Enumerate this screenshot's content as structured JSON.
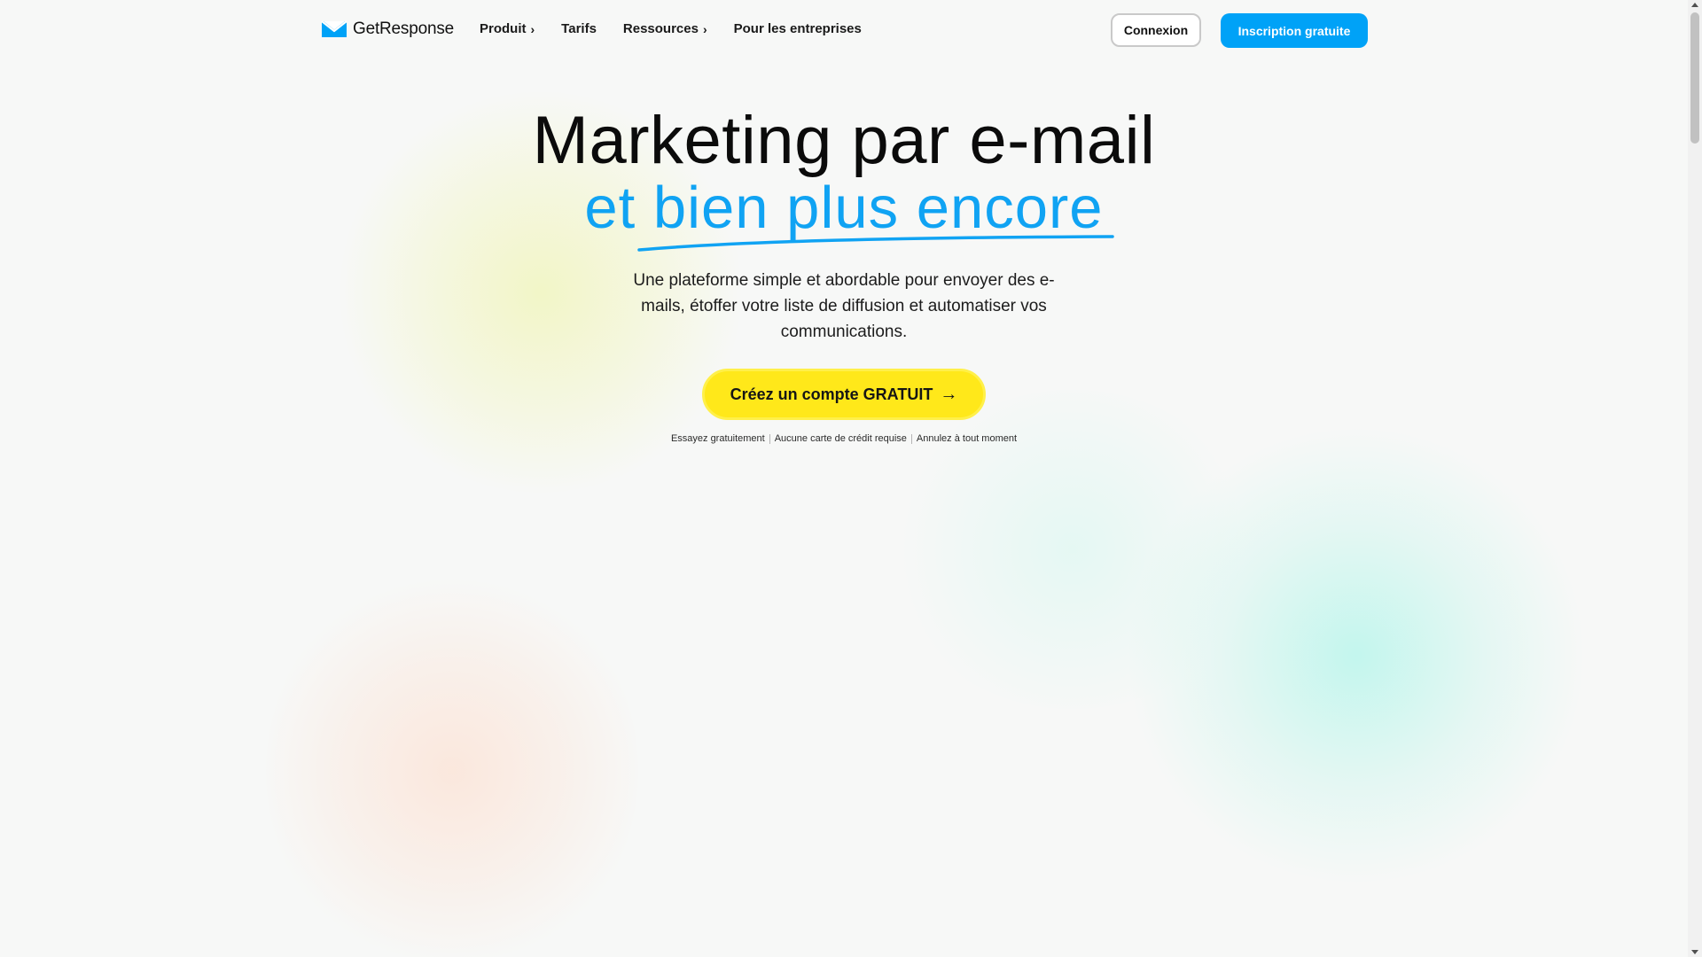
{
  "header": {
    "logo_text": "GetResponse",
    "nav": [
      {
        "label": "Produit",
        "chevron": "›"
      },
      {
        "label": "Tarifs",
        "chevron": ""
      },
      {
        "label": "Ressources",
        "chevron": "›"
      },
      {
        "label": "Pour les entreprises",
        "chevron": ""
      }
    ],
    "login_label": "Connexion",
    "signup_label": "Inscription gratuite"
  },
  "hero": {
    "title_line1": "Marketing par e-mail",
    "title_line2": "et bien plus encore",
    "subtitle": "Une plateforme simple et abordable pour envoyer des e-mails, étoffer votre liste de diffusion et automatiser vos communications.",
    "cta_label": "Créez un compte GRATUIT",
    "cta_arrow": "→",
    "perks": [
      "Essayez gratuitement",
      "Aucune carte de crédit requise",
      "Annulez à tout moment"
    ]
  },
  "colors": {
    "brand_blue": "#00a2f7",
    "title_blue": "#10a3f3",
    "cta_yellow": "#ffe81a"
  },
  "icons": {
    "logo": "envelope-icon",
    "nav_chevron": "chevron-right-icon",
    "cta_arrow": "arrow-right-icon"
  }
}
